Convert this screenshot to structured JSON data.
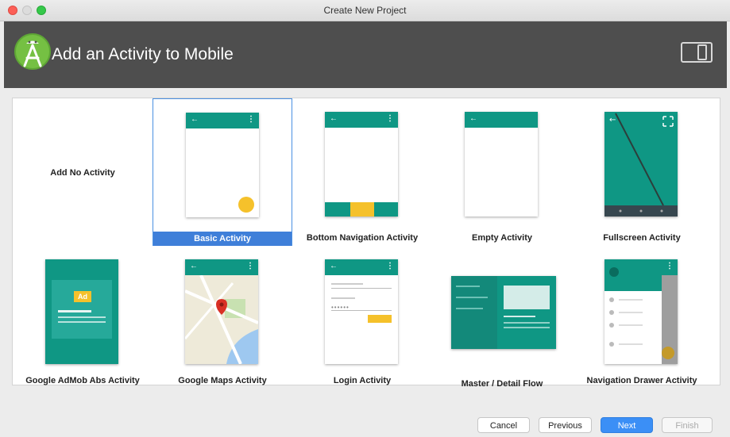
{
  "window": {
    "title": "Create New Project"
  },
  "header": {
    "title": "Add an Activity to Mobile",
    "logo_icon": "android-studio-icon",
    "device_icon": "tablet-phone-icon"
  },
  "activities": [
    {
      "label": "Add No Activity"
    },
    {
      "label": "Basic Activity",
      "selected": true
    },
    {
      "label": "Bottom Navigation Activity"
    },
    {
      "label": "Empty Activity"
    },
    {
      "label": "Fullscreen Activity"
    },
    {
      "label": "Google AdMob Abs Activity",
      "ad_badge": "Ad"
    },
    {
      "label": "Google Maps Activity"
    },
    {
      "label": "Login Activity"
    },
    {
      "label": "Master / Detail Flow"
    },
    {
      "label": "Navigation Drawer Activity"
    }
  ],
  "buttons": {
    "cancel": "Cancel",
    "previous": "Previous",
    "next": "Next",
    "finish": "Finish"
  },
  "colors": {
    "accent": "#0f9784",
    "fab": "#f5c12b",
    "selection": "#3f7fd9",
    "header": "#4e4e4e"
  }
}
